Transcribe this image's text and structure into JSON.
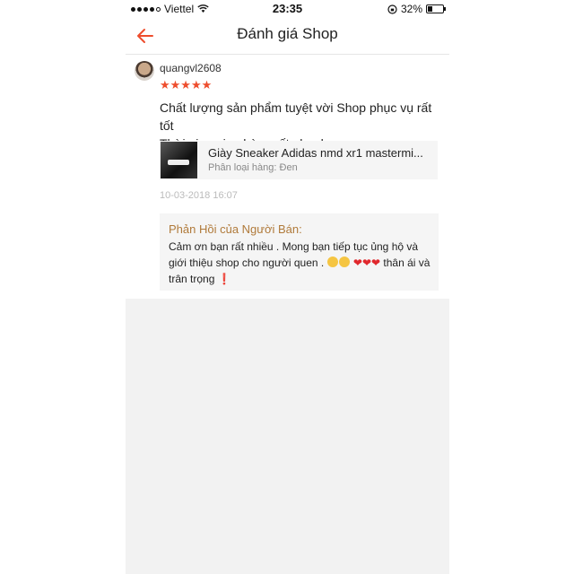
{
  "status_bar": {
    "carrier": "Viettel",
    "time": "23:35",
    "battery_percent": "32%",
    "signal_bars_filled": 4,
    "signal_bars_total": 5,
    "battery_level": 0.32
  },
  "nav": {
    "title": "Đánh giá Shop",
    "back_icon": "back-arrow-icon",
    "accent_color": "#ee4d2d"
  },
  "review": {
    "username": "quangvl2608",
    "rating": 5,
    "stars_text": "★★★★★",
    "comment_line1": "Chất lượng sản phẩm tuyệt vời Shop phục vụ rất tốt",
    "comment_line2": "Thời gian giao hàng rất nhanh",
    "product_name": "Giày Sneaker Adidas nmd xr1 mastermi...",
    "product_variant": "Phân loại hàng: Đen",
    "date": "10-03-2018 16:07"
  },
  "seller_reply": {
    "title": "Phản Hồi của Người Bán:",
    "text_part1": "Cảm ơn bạn rất nhiều . Mong bạn tiếp tục ủng hộ và giới thiệu shop cho người quen .",
    "hearts": "❤❤❤",
    "text_part2": "thân ái và trân trọng",
    "exclamation": "❗"
  }
}
